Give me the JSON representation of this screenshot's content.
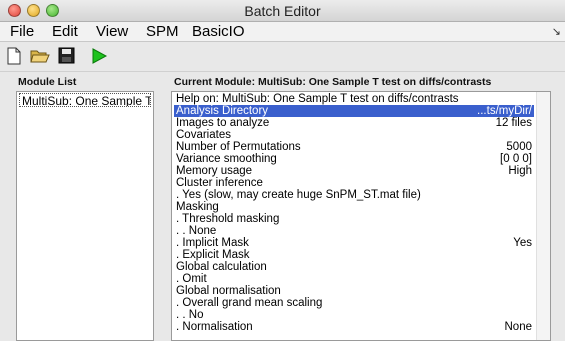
{
  "window": {
    "title": "Batch Editor"
  },
  "menu": [
    "File",
    "Edit",
    "View",
    "SPM",
    "BasicIO"
  ],
  "toolbar": {
    "icons": [
      "new-file-icon",
      "open-folder-icon",
      "save-icon",
      "run-icon"
    ],
    "run_color": "#1ec21e"
  },
  "module_list": {
    "label": "Module List",
    "items": [
      "MultiSub: One Sample T test on diffs/contrasts"
    ]
  },
  "current_module": {
    "label": "Current Module: MultiSub: One Sample T test on diffs/contrasts",
    "rows": [
      {
        "label": "Help on: MultiSub: One Sample T test on diffs/contrasts",
        "value": ""
      },
      {
        "label": "Analysis Directory",
        "value": "...ts/myDir/"
      },
      {
        "label": "Images to analyze",
        "value": "12 files"
      },
      {
        "label": "Covariates",
        "value": ""
      },
      {
        "label": "Number of Permutations",
        "value": "5000"
      },
      {
        "label": "Variance smoothing",
        "value": "[0 0 0]"
      },
      {
        "label": "Memory usage",
        "value": "High"
      },
      {
        "label": "Cluster inference",
        "value": ""
      },
      {
        "label": ". Yes (slow, may create huge SnPM_ST.mat file)",
        "value": ""
      },
      {
        "label": "Masking",
        "value": ""
      },
      {
        "label": ". Threshold masking",
        "value": ""
      },
      {
        "label": ". . None",
        "value": ""
      },
      {
        "label": ". Implicit Mask",
        "value": "Yes"
      },
      {
        "label": ". Explicit Mask",
        "value": ""
      },
      {
        "label": "Global calculation",
        "value": ""
      },
      {
        "label": ". Omit",
        "value": ""
      },
      {
        "label": "Global normalisation",
        "value": ""
      },
      {
        "label": ". Overall grand mean scaling",
        "value": ""
      },
      {
        "label": ". . No",
        "value": ""
      },
      {
        "label": ". Normalisation",
        "value": "None"
      }
    ],
    "selected": "Analysis Directory",
    "selection_color": "#3a5fcd"
  }
}
